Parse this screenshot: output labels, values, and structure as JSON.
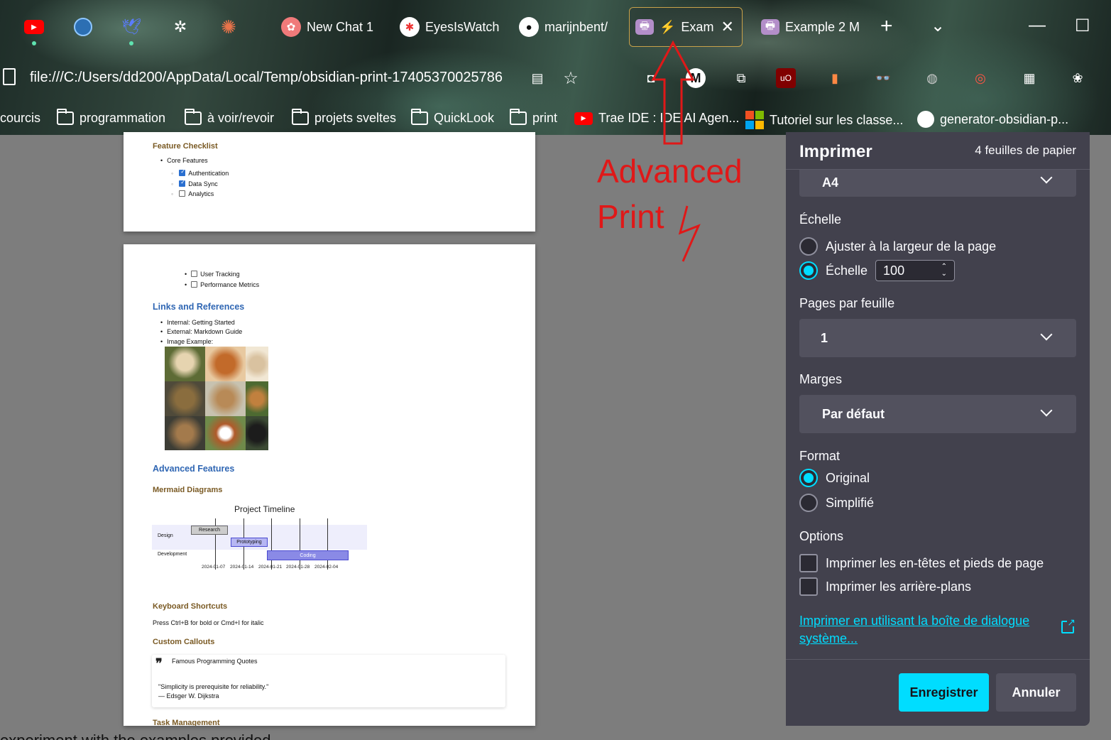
{
  "tabs": {
    "pinned": [
      "youtube",
      "edge-app",
      "bird-app",
      "spider-app",
      "claude"
    ],
    "items": [
      {
        "label": "New Chat 1"
      },
      {
        "label": "EyesIsWatch"
      },
      {
        "label": "marijnbent/"
      },
      {
        "label": "Exam"
      },
      {
        "label": "Example 2 M"
      }
    ],
    "new_tab": "+"
  },
  "address_bar": {
    "url": "file:///C:/Users/dd200/AppData/Local/Temp/obsidian-print-17405370025786"
  },
  "bookmarks": [
    {
      "label": "courcis",
      "icon": "none"
    },
    {
      "label": "programmation",
      "icon": "folder"
    },
    {
      "label": "à voir/revoir",
      "icon": "folder"
    },
    {
      "label": "projets sveltes",
      "icon": "folder"
    },
    {
      "label": "QuickLook",
      "icon": "folder"
    },
    {
      "label": "print",
      "icon": "folder"
    },
    {
      "label": "Trae IDE : IDE AI Agen...",
      "icon": "youtube"
    },
    {
      "label": "Tutoriel sur les classe...",
      "icon": "microsoft"
    },
    {
      "label": "generator-obsidian-p...",
      "icon": "github"
    }
  ],
  "preview": {
    "page1": {
      "heading": "Feature Checklist",
      "group": "Core Features",
      "items": [
        {
          "label": "Authentication",
          "checked": true
        },
        {
          "label": "Data Sync",
          "checked": true
        },
        {
          "label": "Analytics",
          "checked": false
        }
      ]
    },
    "page2": {
      "items": [
        {
          "label": "User Tracking",
          "checked": false
        },
        {
          "label": "Performance Metrics",
          "checked": false
        }
      ],
      "links_heading": "Links and References",
      "links": [
        "Internal: Getting Started",
        "External: Markdown Guide",
        "Image Example:"
      ],
      "advanced_heading": "Advanced Features",
      "mermaid_heading": "Mermaid Diagrams",
      "gantt": {
        "title": "Project Timeline",
        "sections": [
          "Design",
          "Development"
        ],
        "tasks": [
          "Research",
          "Prototyping",
          "Coding"
        ],
        "dates": [
          "2024-01-07",
          "2024-01-14",
          "2024-01-21",
          "2024-01-28",
          "2024-02-04"
        ]
      },
      "shortcuts_heading": "Keyboard Shortcuts",
      "shortcuts_text": "Press Ctrl+B for bold or Cmd+I for italic",
      "callouts_heading": "Custom Callouts",
      "callout_title": "Famous Programming Quotes",
      "quote": "\"Simplicity is prerequisite for reliability.\"",
      "quote_author": "— Edsger W. Dijkstra",
      "task_heading": "Task Management"
    }
  },
  "annotation": {
    "line1": "Advanced",
    "line2": "Print",
    "color": "#e01818"
  },
  "dialog": {
    "title": "Imprimer",
    "sheets": "4 feuilles de papier",
    "paper": "A4",
    "scale_label": "Échelle",
    "fit_width": "Ajuster à la largeur de la page",
    "scale_option": "Échelle",
    "scale_value": "100",
    "pages_per_sheet_label": "Pages par feuille",
    "pages_per_sheet": "1",
    "margins_label": "Marges",
    "margins": "Par défaut",
    "format_label": "Format",
    "format_original": "Original",
    "format_simplified": "Simplifié",
    "options_label": "Options",
    "opt_headers": "Imprimer les en-têtes et pieds de page",
    "opt_backgrounds": "Imprimer les arrière-plans",
    "system_dialog_link": "Imprimer en utilisant la boîte de dialogue système...",
    "save": "Enregistrer",
    "cancel": "Annuler",
    "accent": "#00ddff"
  },
  "bottom_text": "experiment with the examples provided"
}
